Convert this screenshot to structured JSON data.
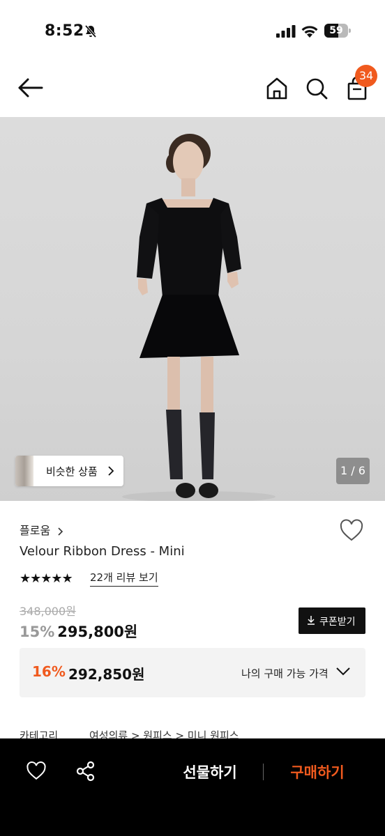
{
  "status_bar": {
    "time": "8:52",
    "battery": "59",
    "battery_level": 0.59,
    "icons": [
      "bell-slash-icon",
      "signal-icon",
      "wifi-icon",
      "battery-icon"
    ]
  },
  "header": {
    "icons": [
      "back-arrow-icon",
      "home-icon",
      "search-icon",
      "shopping-bag-icon"
    ],
    "cart_count": "34"
  },
  "hero": {
    "similar_label": "비슷한 상품",
    "counter": "1 / 6"
  },
  "product": {
    "brand": "플로움",
    "name": "Velour Ribbon Dress - Mini",
    "stars": "★★★★★",
    "rating": 5,
    "review_link": "22개 리뷰 보기",
    "original_price": "348,000원",
    "discount_rate": "15%",
    "sale_price": "295,800원",
    "coupon_label": "쿠폰받기"
  },
  "my_price": {
    "discount_rate": "16%",
    "price": "292,850원",
    "label": "나의 구매 가능 가격"
  },
  "category": {
    "label": "카테고리",
    "path": "여성의류 > 원피스 > 미니 원피스"
  },
  "bottom_bar": {
    "gift_label": "선물하기",
    "buy_label": "구매하기"
  },
  "colors": {
    "accent": "#f05a1e",
    "bottom_bar_bg": "#000000"
  }
}
